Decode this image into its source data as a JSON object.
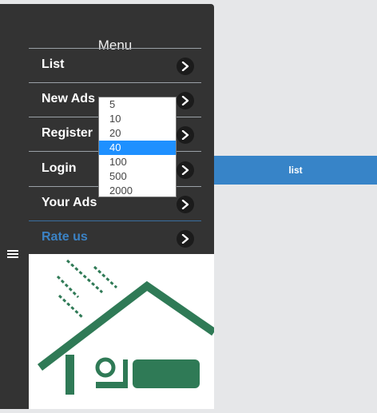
{
  "menu": {
    "title": "Menu",
    "items": [
      {
        "label": "List"
      },
      {
        "label": "New Ads"
      },
      {
        "label": "Register"
      },
      {
        "label": "Login"
      },
      {
        "label": "Your Ads"
      },
      {
        "label": "Rate us"
      }
    ]
  },
  "dropdown": {
    "options": [
      "5",
      "10",
      "20",
      "40",
      "100",
      "500",
      "2000"
    ],
    "selected": "40"
  },
  "list_bar": {
    "label": "list"
  },
  "colors": {
    "panel": "#333333",
    "accent": "#3784c8",
    "dropdown_selected": "#1e90ff",
    "logo_green": "#2f7a56"
  },
  "icons": {
    "hamburger": "menu-icon",
    "chevron": "chevron-right-icon",
    "logo": "house-logo"
  }
}
